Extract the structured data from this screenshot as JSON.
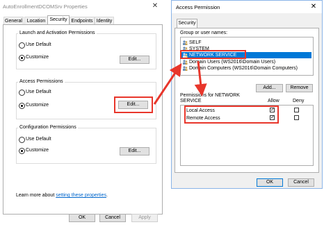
{
  "props": {
    "title": "AutoEnrollmentDCOMSrv Properties",
    "close_glyph": "✕",
    "tabs": [
      "General",
      "Location",
      "Security",
      "Endpoints",
      "Identity"
    ],
    "groups": {
      "launch": {
        "title": "Launch and Activation Permissions",
        "use_default": "Use Default",
        "customize": "Customize",
        "edit": "Edit..."
      },
      "access": {
        "title": "Access Permissions",
        "use_default": "Use Default",
        "customize": "Customize",
        "edit": "Edit..."
      },
      "config": {
        "title": "Configuration Permissions",
        "use_default": "Use Default",
        "customize": "Customize",
        "edit": "Edit..."
      }
    },
    "learn_more_prefix": "Learn more about ",
    "learn_more_link": "setting these properties",
    "learn_more_suffix": ".",
    "buttons": {
      "ok": "OK",
      "cancel": "Cancel",
      "apply": "Apply"
    }
  },
  "dialog": {
    "title": "Access Permission",
    "close_glyph": "✕",
    "tab": "Security",
    "group_label": "Group or user names:",
    "users": [
      {
        "name": "SELF",
        "selected": false
      },
      {
        "name": "SYSTEM",
        "selected": false
      },
      {
        "name": "NETWORK SERVICE",
        "selected": true
      },
      {
        "name": "Domain Users (WS2016\\Domain Users)",
        "selected": false
      },
      {
        "name": "Domain Computers (WS2016\\Domain Computers)",
        "selected": false
      }
    ],
    "add_label": "Add...",
    "remove_label": "Remove",
    "perm_label_line1": "Permissions for NETWORK",
    "perm_label_line2": "SERVICE",
    "allow_label": "Allow",
    "deny_label": "Deny",
    "permissions": [
      {
        "name": "Local Access",
        "allow": true,
        "deny": false
      },
      {
        "name": "Remote Access",
        "allow": true,
        "deny": false
      }
    ],
    "ok_label": "OK",
    "cancel_label": "Cancel"
  },
  "colors": {
    "highlight": "#e8362b",
    "selection": "#0078d7",
    "link": "#0066cc"
  }
}
